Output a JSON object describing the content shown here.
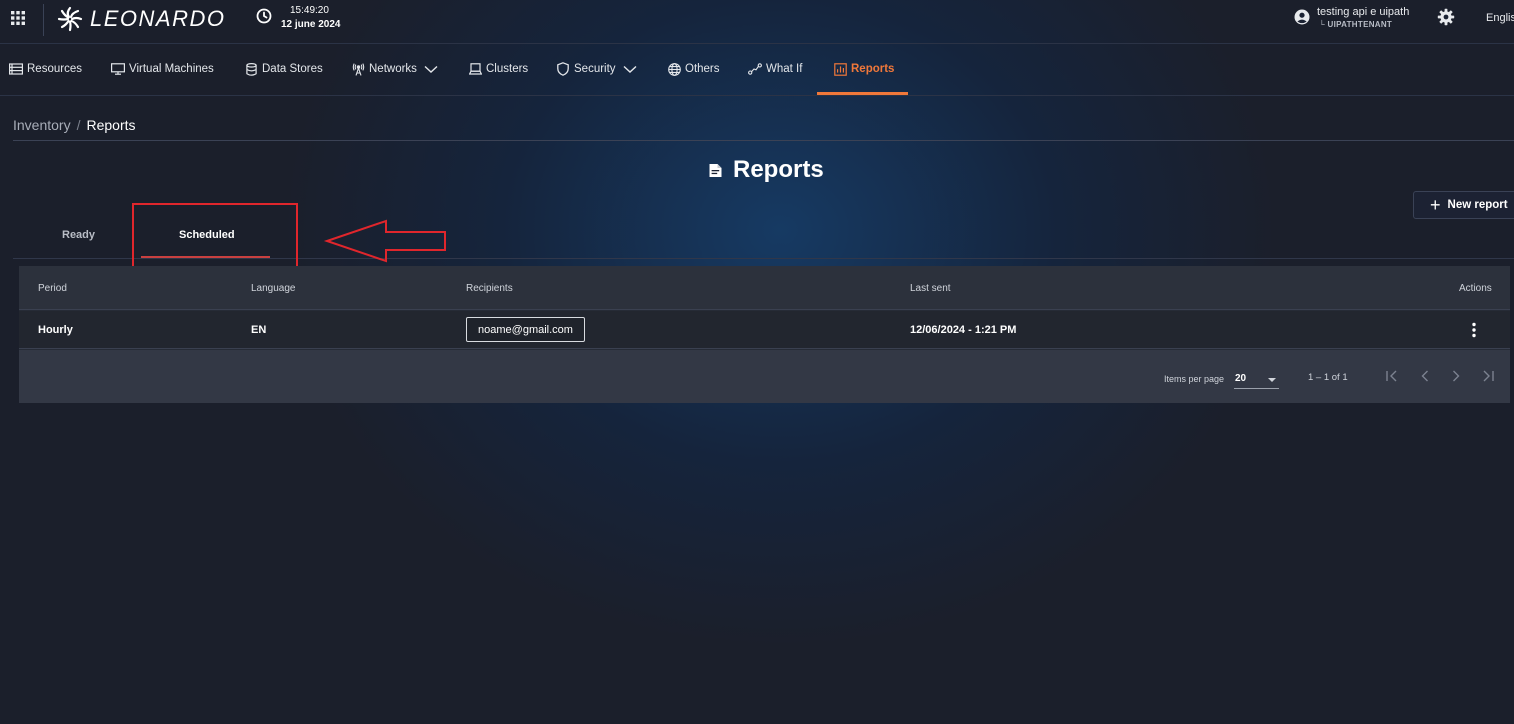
{
  "app": {
    "brand": "LEONARDO",
    "time": "15:49:20",
    "date": "12 june 2024",
    "user_name": "testing api e uipath",
    "user_tenant": "└ UIPATHTENANT",
    "language": "Englis"
  },
  "nav": {
    "items": [
      {
        "label": "Resources",
        "icon": "server-icon"
      },
      {
        "label": "Virtual Machines",
        "icon": "monitor-icon"
      },
      {
        "label": "Data Stores",
        "icon": "database-icon"
      },
      {
        "label": "Networks",
        "icon": "antenna-icon",
        "dropdown": true
      },
      {
        "label": "Clusters",
        "icon": "laptop-icon"
      },
      {
        "label": "Security",
        "icon": "shield-icon",
        "dropdown": true
      },
      {
        "label": "Others",
        "icon": "globe-icon"
      },
      {
        "label": "What If",
        "icon": "route-icon"
      },
      {
        "label": "Reports",
        "icon": "report-icon",
        "active": true
      }
    ]
  },
  "breadcrumb": {
    "root": "Inventory",
    "separator": "/",
    "current": "Reports"
  },
  "page": {
    "title": "Reports",
    "new_report": "New report"
  },
  "tabs": {
    "ready": "Ready",
    "scheduled": "Scheduled",
    "active": "Scheduled"
  },
  "table": {
    "headers": {
      "period": "Period",
      "language": "Language",
      "recipients": "Recipients",
      "last_sent": "Last sent",
      "actions": "Actions"
    },
    "rows": [
      {
        "period": "Hourly",
        "language": "EN",
        "recipients": "noame@gmail.com",
        "last_sent": "12/06/2024 - 1:21 PM"
      }
    ]
  },
  "pagination": {
    "items_per_page_label": "Items per page",
    "items_per_page": "20",
    "range": "1 – 1 of 1"
  },
  "colors": {
    "accent": "#f0783a",
    "tab_underline": "#c94040",
    "annotation": "#e0262c",
    "background": "#1b1f2b"
  }
}
